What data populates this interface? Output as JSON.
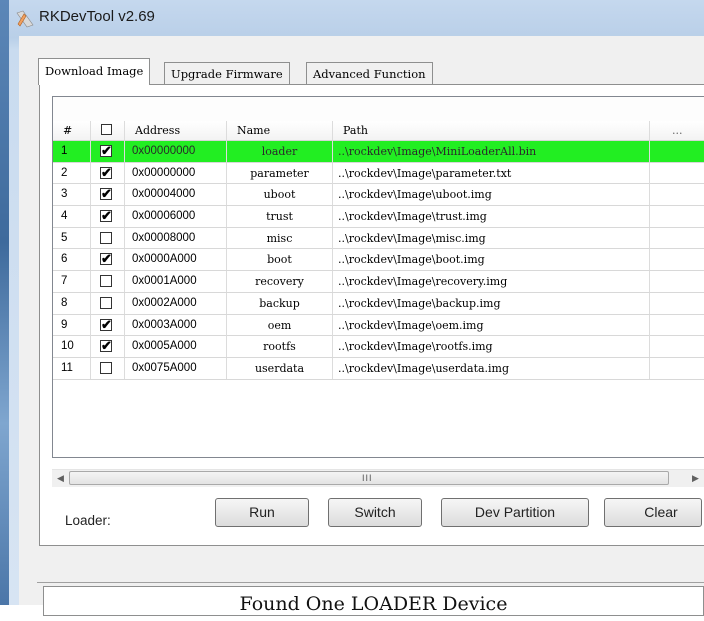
{
  "window": {
    "title": "RKDevTool v2.69"
  },
  "tabs": [
    {
      "label": "Download Image",
      "active": true
    },
    {
      "label": "Upgrade Firmware",
      "active": false
    },
    {
      "label": "Advanced Function",
      "active": false
    }
  ],
  "table": {
    "headers": {
      "num": "#",
      "address": "Address",
      "name": "Name",
      "path": "Path",
      "more": "..."
    },
    "rows": [
      {
        "num": "1",
        "checked": true,
        "address": "0x00000000",
        "name": "loader",
        "path": "..\\rockdev\\Image\\MiniLoaderAll.bin",
        "selected": true
      },
      {
        "num": "2",
        "checked": true,
        "address": "0x00000000",
        "name": "parameter",
        "path": "..\\rockdev\\Image\\parameter.txt"
      },
      {
        "num": "3",
        "checked": true,
        "address": "0x00004000",
        "name": "uboot",
        "path": "..\\rockdev\\Image\\uboot.img"
      },
      {
        "num": "4",
        "checked": true,
        "address": "0x00006000",
        "name": "trust",
        "path": "..\\rockdev\\Image\\trust.img"
      },
      {
        "num": "5",
        "checked": false,
        "address": "0x00008000",
        "name": "misc",
        "path": "..\\rockdev\\Image\\misc.img"
      },
      {
        "num": "6",
        "checked": true,
        "address": "0x0000A000",
        "name": "boot",
        "path": "..\\rockdev\\Image\\boot.img"
      },
      {
        "num": "7",
        "checked": false,
        "address": "0x0001A000",
        "name": "recovery",
        "path": "..\\rockdev\\Image\\recovery.img"
      },
      {
        "num": "8",
        "checked": false,
        "address": "0x0002A000",
        "name": "backup",
        "path": "..\\rockdev\\Image\\backup.img"
      },
      {
        "num": "9",
        "checked": true,
        "address": "0x0003A000",
        "name": "oem",
        "path": "..\\rockdev\\Image\\oem.img"
      },
      {
        "num": "10",
        "checked": true,
        "address": "0x0005A000",
        "name": "rootfs",
        "path": "..\\rockdev\\Image\\rootfs.img"
      },
      {
        "num": "11",
        "checked": false,
        "address": "0x0075A000",
        "name": "userdata",
        "path": "..\\rockdev\\Image\\userdata.img"
      }
    ]
  },
  "scrollbar": {
    "grip": "III"
  },
  "controls": {
    "loader_label": "Loader:",
    "run": "Run",
    "switch": "Switch",
    "dev_partition": "Dev Partition",
    "clear": "Clear"
  },
  "status": {
    "text": "Found One LOADER Device"
  },
  "colors": {
    "selected_row": "#22ee22",
    "title_bar": "#c5d8ee"
  }
}
